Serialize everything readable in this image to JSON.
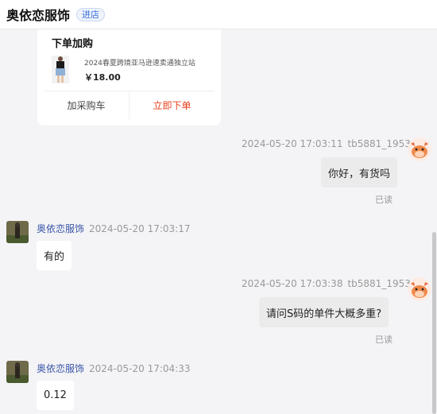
{
  "header": {
    "shop_name": "奥依恋服饰",
    "enter_label": "进店"
  },
  "order_card": {
    "title": "下单加购",
    "product_name": "2024春夏跨境亚马逊速卖通独立站",
    "price": "￥18.00",
    "add_cart_label": "加采购车",
    "buy_now_label": "立即下单"
  },
  "messages": [
    {
      "from": "buyer",
      "nick": "tb5881_1953",
      "time": "2024-05-20 17:03:11",
      "text": "你好，有货吗",
      "status": "已读"
    },
    {
      "from": "shop",
      "nick": "奥依恋服饰",
      "time": "2024-05-20 17:03:17",
      "text": "有的"
    },
    {
      "from": "buyer",
      "nick": "tb5881_1953",
      "time": "2024-05-20 17:03:38",
      "text": "请问S码的单件大概多重?",
      "status": "已读"
    },
    {
      "from": "shop",
      "nick": "奥依恋服饰",
      "time": "2024-05-20 17:04:33",
      "text": "0.12"
    }
  ],
  "colors": {
    "accent_buy": "#e8401e",
    "shop_name_link": "#3a55a8",
    "badge": "#3a6fd8"
  },
  "icons": {
    "buyer_avatar": "cartoon-cow-avatar-icon",
    "shop_avatar": "shop-logo-avatar"
  }
}
